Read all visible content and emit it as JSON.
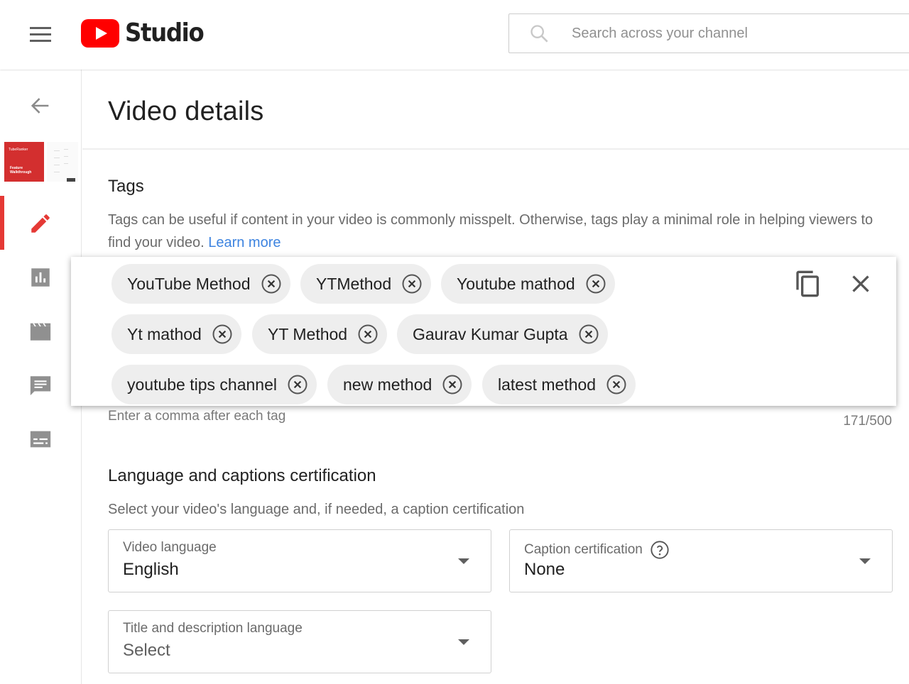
{
  "header": {
    "logo_text": "Studio",
    "search_placeholder": "Search across your channel"
  },
  "sidebar": {
    "thumbnail": {
      "brand_text": "TubeRanker",
      "title_text": "Feature Walkthrough"
    },
    "items": [
      {
        "name": "details",
        "icon": "pencil-icon",
        "active": true
      },
      {
        "name": "analytics",
        "icon": "analytics-icon",
        "active": false
      },
      {
        "name": "editor",
        "icon": "clapperboard-icon",
        "active": false
      },
      {
        "name": "comments",
        "icon": "comment-icon",
        "active": false
      },
      {
        "name": "subtitles",
        "icon": "subtitles-icon",
        "active": false
      }
    ]
  },
  "main": {
    "page_title": "Video details",
    "tags": {
      "title": "Tags",
      "description": "Tags can be useful if content in your video is commonly misspelt. Otherwise, tags play a minimal role in helping viewers to find your video.",
      "learn_more": "Learn more",
      "chips": [
        "YouTube Method",
        "YTMethod",
        "Youtube mathod",
        "Yt mathod",
        "YT Method",
        "Gaurav Kumar Gupta",
        "youtube tips channel",
        "new method",
        "latest method"
      ],
      "helper": "Enter a comma after each tag",
      "counter": "171/500"
    },
    "language": {
      "title": "Language and captions certification",
      "description": "Select your video's language and, if needed, a caption certification",
      "video_language": {
        "label": "Video language",
        "value": "English"
      },
      "caption_certification": {
        "label": "Caption certification",
        "value": "None"
      },
      "title_desc_language": {
        "label": "Title and description language",
        "value": "Select"
      }
    }
  },
  "colors": {
    "brand_red": "#ff0000",
    "active_red": "#e53935",
    "link_blue": "#3e84e0",
    "chip_bg": "#eeeeee"
  }
}
